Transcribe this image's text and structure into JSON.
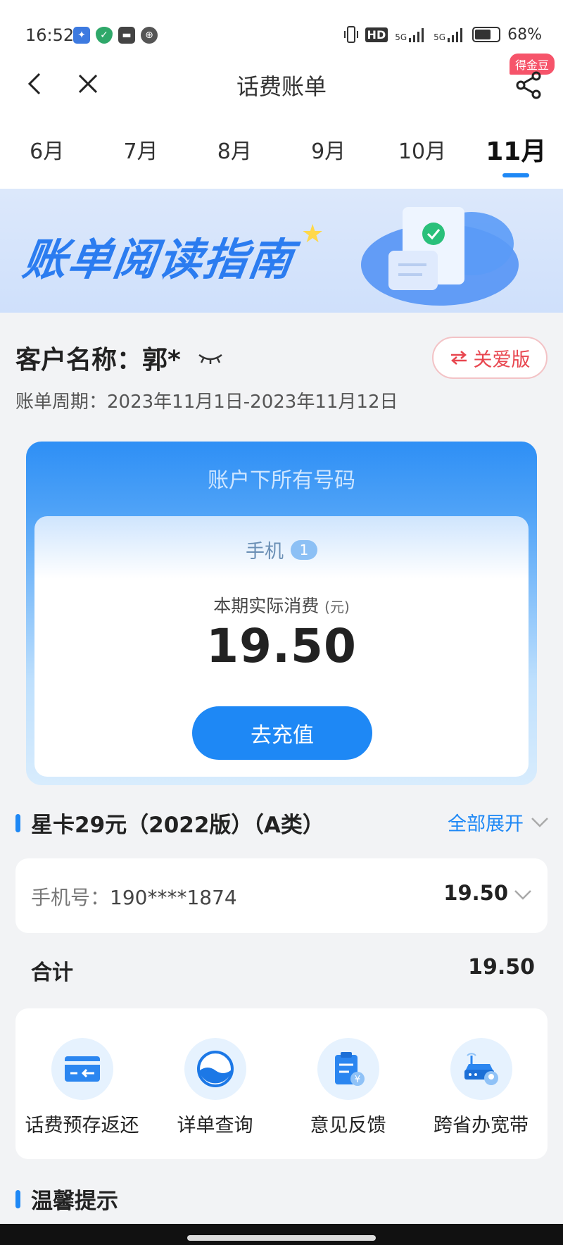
{
  "status_bar": {
    "time": "16:52",
    "battery": "68%",
    "battery_level": 0.68,
    "network_label": "HD",
    "signal_label": "5G"
  },
  "nav": {
    "title": "话费账单",
    "badge": "得金豆"
  },
  "months": [
    {
      "label": "6月",
      "active": false
    },
    {
      "label": "7月",
      "active": false
    },
    {
      "label": "8月",
      "active": false
    },
    {
      "label": "9月",
      "active": false
    },
    {
      "label": "10月",
      "active": false
    },
    {
      "label": "11月",
      "active": true
    }
  ],
  "banner": {
    "title": "账单阅读指南"
  },
  "customer": {
    "name_label": "客户名称：郭*",
    "period": "账单周期：2023年11月1日-2023年11月12日",
    "care_label": "关爱版"
  },
  "account": {
    "title": "账户下所有号码",
    "phone_label": "手机",
    "phone_count": "1",
    "consume_label": "本期实际消费",
    "consume_unit": "(元)",
    "amount": "19.50",
    "recharge_label": "去充值"
  },
  "plan": {
    "title": "星卡29元（2022版）（A类）",
    "expand_label": "全部展开"
  },
  "number_item": {
    "label": "手机号：",
    "number": "190****1874",
    "amount": "19.50"
  },
  "total": {
    "label": "合计",
    "amount": "19.50"
  },
  "services": [
    {
      "label": "话费预存返还",
      "icon": "card-return-icon"
    },
    {
      "label": "详单查询",
      "icon": "bill-detail-icon"
    },
    {
      "label": "意见反馈",
      "icon": "feedback-icon"
    },
    {
      "label": "跨省办宽带",
      "icon": "broadband-icon"
    }
  ],
  "tips": {
    "title": "温馨提示"
  },
  "colors": {
    "accent": "#1e88f5",
    "care_red": "#e8464f",
    "badge_red": "#f6546a"
  }
}
